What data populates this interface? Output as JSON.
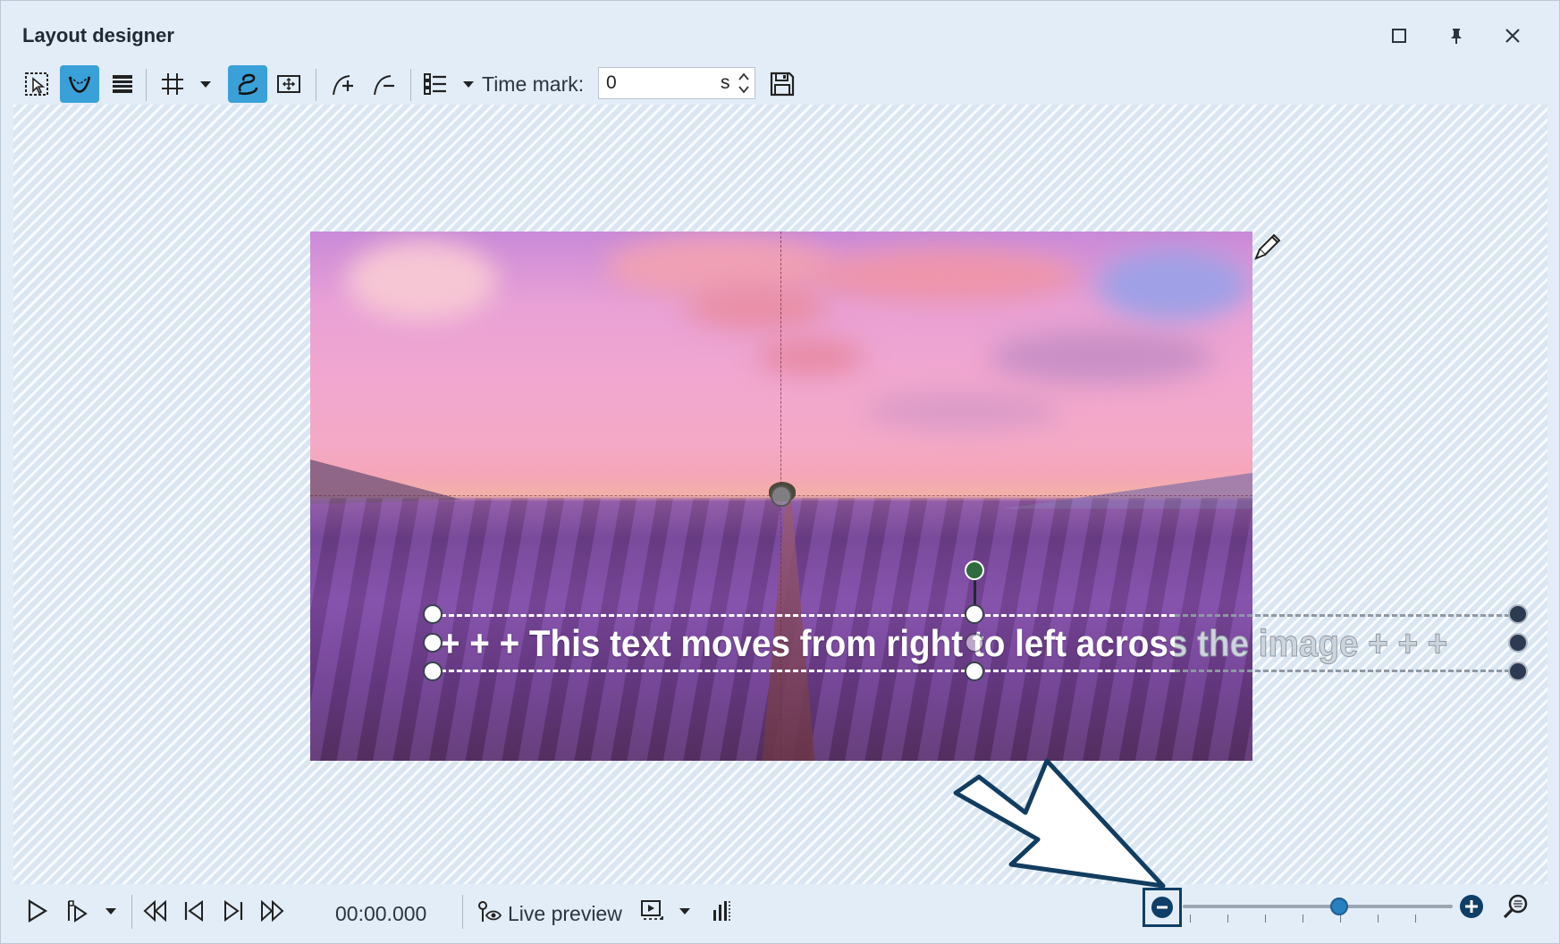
{
  "window": {
    "title": "Layout designer"
  },
  "toolbar": {
    "time_mark_label": "Time mark:",
    "time_mark_value": "0",
    "time_mark_unit": "s",
    "icons": [
      "select-area-icon",
      "curve-edit-icon",
      "layers-icon",
      "grid-icon",
      "dropdown-icon",
      "motion-path-icon",
      "camera-pan-icon",
      "add-keyframe-icon",
      "remove-keyframe-icon",
      "list-icon",
      "dropdown-icon",
      "save-icon"
    ]
  },
  "canvas": {
    "text_object": "+ + + This text moves from right to left across the image + + +"
  },
  "playback": {
    "time": "00:00.000",
    "live_preview_label": "Live preview"
  },
  "zoom": {
    "level": 0.58
  },
  "colors": {
    "accent": "#3aa0d8",
    "zoom_dark": "#0f3f66",
    "background": "#e3edf7"
  }
}
